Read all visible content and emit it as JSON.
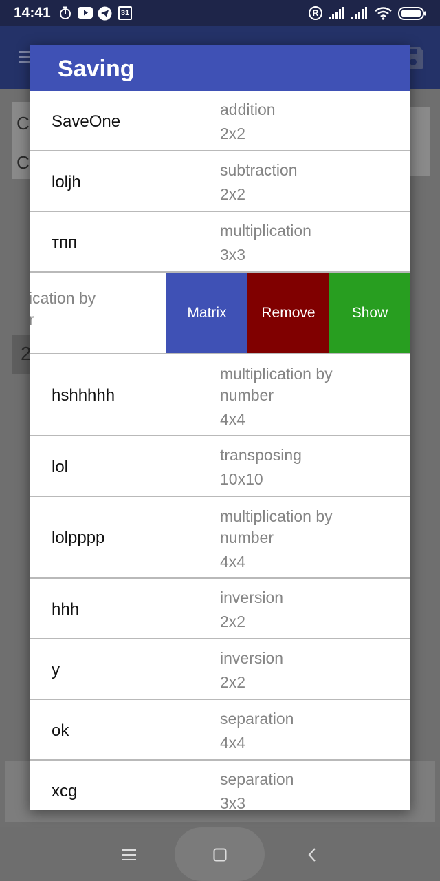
{
  "status_bar": {
    "time": "14:41",
    "icons": [
      "timer-icon",
      "youtube-icon",
      "telegram-icon",
      "calendar-icon",
      "registered-icon",
      "signal-icon",
      "signal-icon-2",
      "wifi-icon",
      "battery-icon"
    ],
    "calendar_day": "31",
    "registered": "R"
  },
  "dialog": {
    "title": "Saving",
    "header_color": "#3f51b5"
  },
  "saves": [
    {
      "name": "SaveOne",
      "operation": "addition",
      "size": "2x2"
    },
    {
      "name": "loljh",
      "operation": "subtraction",
      "size": "2x2"
    },
    {
      "name": "тпп",
      "operation": "multiplication",
      "size": "3x3"
    },
    {
      "name": "hshhhhh",
      "operation_line1": "multiplication by",
      "operation_line2": "number",
      "size": "4x4"
    },
    {
      "name": "lol",
      "operation": "transposing",
      "size": "10x10"
    },
    {
      "name": "lolpppp",
      "operation_line1": "multiplication by",
      "operation_line2": "number",
      "size": "4x4"
    },
    {
      "name": "hhh",
      "operation": "inversion",
      "size": "2x2"
    },
    {
      "name": "y",
      "operation": "inversion",
      "size": "2x2"
    },
    {
      "name": "ok",
      "operation": "separation",
      "size": "4x4"
    },
    {
      "name": "xcg",
      "operation": "separation",
      "size": "3x3"
    }
  ],
  "swiped_row": {
    "visible_text_line1": "ication by",
    "visible_text_line2": "r",
    "actions": {
      "matrix": "Matrix",
      "remove": "Remove",
      "show": "Show"
    },
    "colors": {
      "matrix": "#3f51b5",
      "remove": "#800000",
      "show": "#289e20"
    }
  },
  "background": {
    "row1_letter": "C",
    "row2_letter": "C",
    "side_number": "2"
  },
  "nav_bar": {
    "icons": [
      "menu-nav-icon",
      "home-nav-icon",
      "back-nav-icon"
    ]
  }
}
